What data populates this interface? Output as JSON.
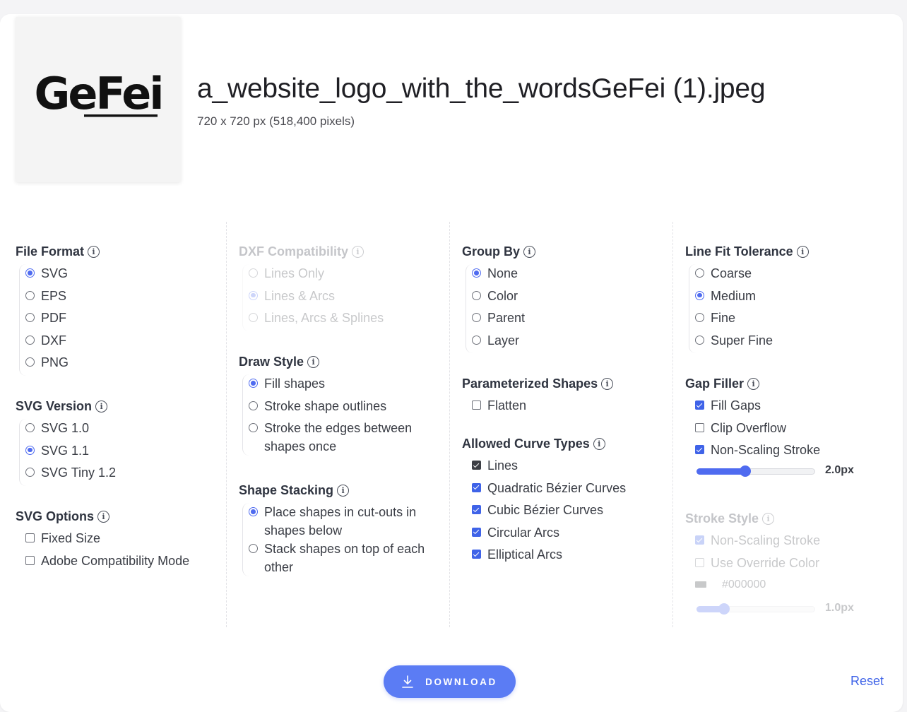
{
  "file": {
    "name": "a_website_logo_with_the_wordsGeFei (1).jpeg",
    "dimensions": "720 x 720 px (518,400 pixels)",
    "logo_text": "GeFei"
  },
  "col1": {
    "file_format": {
      "title": "File Format",
      "options": [
        "SVG",
        "EPS",
        "PDF",
        "DXF",
        "PNG"
      ],
      "selected": "SVG"
    },
    "svg_version": {
      "title": "SVG Version",
      "options": [
        "SVG 1.0",
        "SVG 1.1",
        "SVG Tiny 1.2"
      ],
      "selected": "SVG 1.1"
    },
    "svg_options": {
      "title": "SVG Options",
      "options": [
        "Fixed Size",
        "Adobe Compatibility Mode"
      ]
    }
  },
  "col2": {
    "dxf_compat": {
      "title": "DXF Compatibility",
      "options": [
        "Lines Only",
        "Lines & Arcs",
        "Lines, Arcs & Splines"
      ],
      "selected": "Lines & Arcs",
      "disabled": true
    },
    "draw_style": {
      "title": "Draw Style",
      "options": [
        "Fill shapes",
        "Stroke shape outlines",
        "Stroke the edges between shapes once"
      ],
      "selected": "Fill shapes"
    },
    "shape_stacking": {
      "title": "Shape Stacking",
      "options": [
        "Place shapes in cut-outs in shapes below",
        "Stack shapes on top of each other"
      ],
      "selected": "Place shapes in cut-outs in shapes below"
    }
  },
  "col3": {
    "group_by": {
      "title": "Group By",
      "options": [
        "None",
        "Color",
        "Parent",
        "Layer"
      ],
      "selected": "None"
    },
    "param_shapes": {
      "title": "Parameterized Shapes",
      "options": [
        "Flatten"
      ]
    },
    "curve_types": {
      "title": "Allowed Curve Types",
      "options": [
        "Lines",
        "Quadratic Bézier Curves",
        "Cubic Bézier Curves",
        "Circular Arcs",
        "Elliptical Arcs"
      ]
    }
  },
  "col4": {
    "line_fit": {
      "title": "Line Fit Tolerance",
      "options": [
        "Coarse",
        "Medium",
        "Fine",
        "Super Fine"
      ],
      "selected": "Medium"
    },
    "gap_filler": {
      "title": "Gap Filler",
      "options": [
        "Fill Gaps",
        "Clip Overflow",
        "Non-Scaling Stroke"
      ],
      "slider_value": "2.0px",
      "slider_fraction": 0.41
    },
    "stroke_style": {
      "title": "Stroke Style",
      "options": [
        "Non-Scaling Stroke",
        "Use Override Color"
      ],
      "color": "#000000",
      "slider_value": "1.0px",
      "slider_fraction": 0.23,
      "disabled": true
    }
  },
  "actions": {
    "download": "DOWNLOAD",
    "reset": "Reset"
  },
  "colors": {
    "accent": "#4f6bf0",
    "button": "#5b7cf4",
    "link": "#3f63e8"
  }
}
